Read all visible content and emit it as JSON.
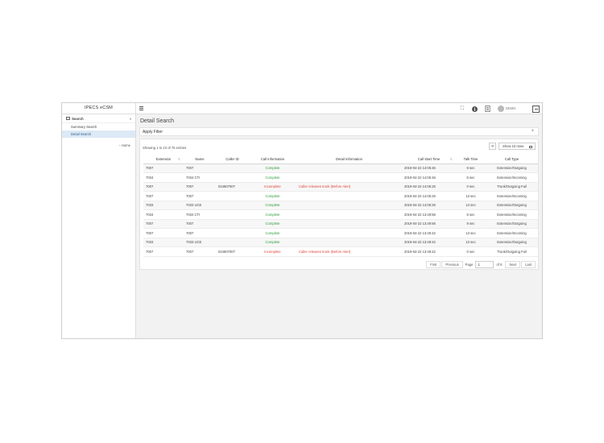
{
  "brand": "IPECS eCSM",
  "sidebar": {
    "group_label": "Search",
    "items": [
      {
        "label": "Summary Search",
        "active": false
      },
      {
        "label": "Detail Search",
        "active": true
      }
    ],
    "footer": "‹ Home"
  },
  "topbar": {
    "user_name": "DEMO",
    "icons": [
      "fullscreen-icon",
      "info-icon",
      "document-icon",
      "user-avatar",
      "logout-icon"
    ]
  },
  "main": {
    "title": "Detail Search",
    "filter_label": "Apply Filter",
    "filter_toggle": "+",
    "showing": "Showing 1 to 10 of 75 entries",
    "show_rows": "Show 10 rows"
  },
  "table": {
    "columns": [
      "Extension",
      "Name",
      "Caller ID",
      "Call Information",
      "Detail Information",
      "Call Start Time",
      "Talk Time",
      "Call Type"
    ],
    "rows": [
      [
        "7007",
        "7007",
        "",
        "Complete",
        "",
        "2019-04-22 14:05:46",
        "8 sec",
        "Extension/Outgoing"
      ],
      [
        "7034",
        "7034 CTI",
        "",
        "Complete",
        "",
        "2019-04-22 14:05:46",
        "8 sec",
        "Extension/Incoming"
      ],
      [
        "7007",
        "7007",
        "024807007",
        "Incomplete",
        "Caller releases trunk (Before Alert)",
        "2019-04-22 14:05:25",
        "0 sec",
        "Trunk/Outgoing Fail"
      ],
      [
        "7007",
        "7007",
        "",
        "Complete",
        "",
        "2019-04-22 14:05:25",
        "13 sec",
        "Extension/Incoming"
      ],
      [
        "7033",
        "7033 UCE",
        "",
        "Complete",
        "",
        "2019-04-22 14:05:25",
        "13 sec",
        "Extension/Outgoing"
      ],
      [
        "7034",
        "7034 CTI",
        "",
        "Complete",
        "",
        "2019-04-22 13:49:56",
        "8 sec",
        "Extension/Incoming"
      ],
      [
        "7007",
        "7007",
        "",
        "Complete",
        "",
        "2019-04-22 13:49:56",
        "8 sec",
        "Extension/Outgoing"
      ],
      [
        "7007",
        "7007",
        "",
        "Complete",
        "",
        "2019-04-22 13:49:42",
        "13 sec",
        "Extension/Incoming"
      ],
      [
        "7033",
        "7033 UCE",
        "",
        "Complete",
        "",
        "2019-04-22 13:49:42",
        "13 sec",
        "Extension/Outgoing"
      ],
      [
        "7007",
        "7007",
        "024807007",
        "Incomplete",
        "Caller releases trunk (Before Alert)",
        "2019-04-22 13:49:42",
        "0 sec",
        "Trunk/Outgoing Fail"
      ]
    ]
  },
  "pager": {
    "first": "First",
    "previous": "Previous",
    "page_label": "Page",
    "page_value": "1",
    "of_label": "of 8",
    "next": "Next",
    "last": "Last"
  },
  "colors": {
    "complete": "#2e9e3c",
    "incomplete": "#e0453a",
    "active_bg": "#dce9f6"
  }
}
